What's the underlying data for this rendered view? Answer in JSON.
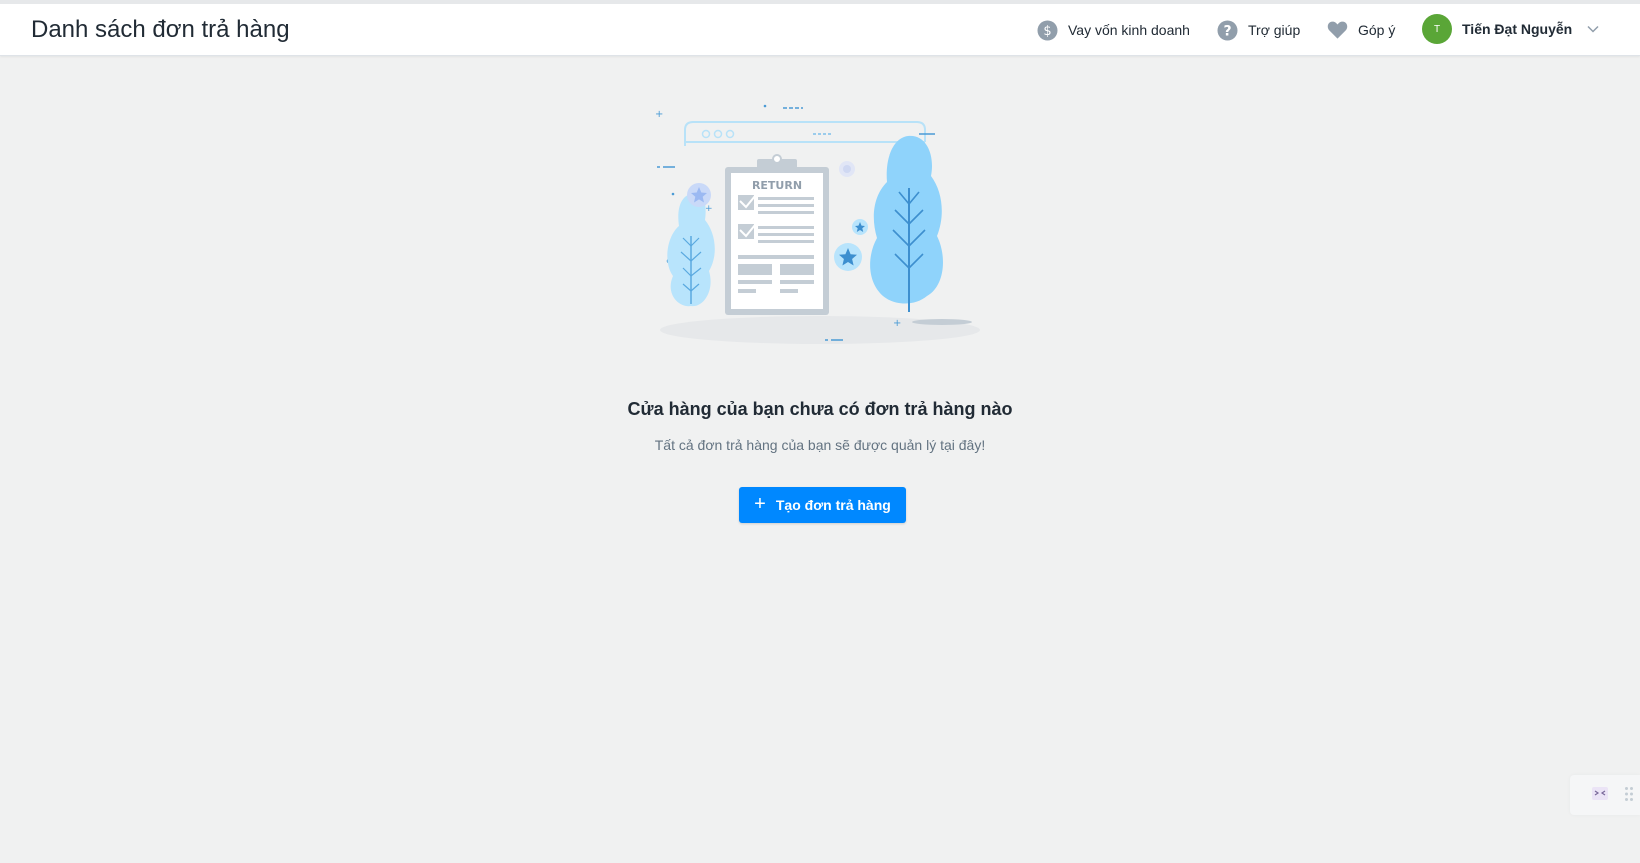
{
  "header": {
    "title": "Danh sách đơn trả hàng",
    "loan": {
      "label": "Vay vốn kinh doanh",
      "icon": "dollar-circle-icon"
    },
    "help": {
      "label": "Trợ giúp",
      "icon": "question-circle-icon"
    },
    "feedback": {
      "label": "Góp ý",
      "icon": "heart-icon"
    },
    "user": {
      "initial": "T",
      "name": "Tiến Đạt Nguyễn",
      "avatar_color": "#5aa637"
    }
  },
  "illustration": {
    "clipboard_label": "RETURN"
  },
  "empty_state": {
    "title": "Cửa hàng của bạn chưa có đơn trả hàng nào",
    "subtitle": "Tất cả đơn trả hàng của bạn sẽ được quản lý tại đây!",
    "button_icon": "+",
    "button_label": "Tạo đơn trả hàng"
  },
  "colors": {
    "primary": "#0088ff",
    "background": "#f0f1f1",
    "header_bg": "#ffffff",
    "tree": "#8fd3fb"
  }
}
